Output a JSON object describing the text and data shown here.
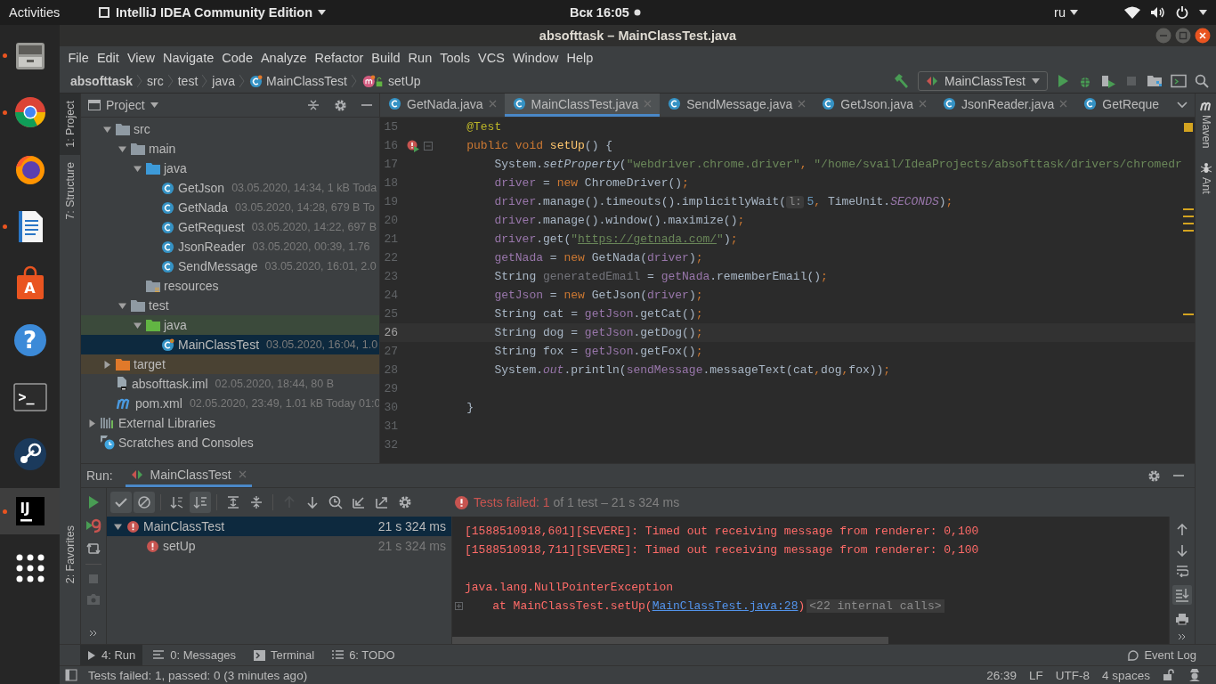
{
  "top_bar": {
    "activities": "Activities",
    "app_menu": "IntelliJ IDEA Community Edition",
    "clock": "Вск 16:05",
    "notification": true,
    "input_source": "ru"
  },
  "dock": [
    {
      "kind": "files",
      "running": true
    },
    {
      "kind": "browser",
      "running": true
    },
    {
      "kind": "fox-browser",
      "running": false
    },
    {
      "kind": "document",
      "running": true
    },
    {
      "kind": "store",
      "glyph": "A",
      "running": false
    },
    {
      "kind": "help",
      "glyph": "?",
      "running": false
    },
    {
      "kind": "terminal",
      "glyph": ">_",
      "running": false
    },
    {
      "kind": "steam",
      "running": false
    },
    {
      "kind": "ide",
      "glyph": "IJ",
      "running": true,
      "selected": true
    },
    {
      "kind": "apps",
      "running": false
    }
  ],
  "window": {
    "title": "absofttask – MainClassTest.java"
  },
  "menu": [
    "File",
    "Edit",
    "View",
    "Navigate",
    "Code",
    "Analyze",
    "Refactor",
    "Build",
    "Run",
    "Tools",
    "VCS",
    "Window",
    "Help"
  ],
  "breadcrumbs": [
    {
      "label": "absofttask",
      "kind": "project"
    },
    {
      "label": "src",
      "kind": "folder"
    },
    {
      "label": "test",
      "kind": "folder"
    },
    {
      "label": "java",
      "kind": "folder"
    },
    {
      "label": "MainClassTest",
      "kind": "class"
    },
    {
      "label": "setUp",
      "kind": "method"
    }
  ],
  "run_config": "MainClassTest",
  "left_tools": [
    {
      "label": "1: Project",
      "selected": true
    },
    {
      "label": "7: Structure",
      "selected": false
    }
  ],
  "left_tools_bottom": [
    {
      "label": "2: Favorites",
      "selected": false
    }
  ],
  "right_tools": [
    {
      "label": "Maven",
      "kind": "maven"
    },
    {
      "label": "Ant",
      "kind": "ant"
    }
  ],
  "project_panel": {
    "title": "Project",
    "tree": [
      {
        "kind": "module-root",
        "children": [
          {
            "name": "src",
            "kind": "folder",
            "expanded": true,
            "selected": false,
            "children": [
              {
                "name": "main",
                "kind": "folder",
                "expanded": true,
                "selected": false,
                "children": [
                  {
                    "name": "java",
                    "kind": "source-folder",
                    "expanded": true,
                    "selected": false,
                    "children": [
                      {
                        "name": "GetJson",
                        "kind": "class",
                        "meta": "03.05.2020, 14:34, 1 kB Toda",
                        "selected": false
                      },
                      {
                        "name": "GetNada",
                        "kind": "class",
                        "meta": "03.05.2020, 14:28, 679 B To",
                        "selected": false
                      },
                      {
                        "name": "GetRequest",
                        "kind": "class",
                        "meta": "03.05.2020, 14:22, 697 B",
                        "selected": false
                      },
                      {
                        "name": "JsonReader",
                        "kind": "class",
                        "meta": "03.05.2020, 00:39, 1.76",
                        "selected": false
                      },
                      {
                        "name": "SendMessage",
                        "kind": "class",
                        "meta": "03.05.2020, 16:01, 2.0",
                        "selected": false
                      }
                    ]
                  },
                  {
                    "name": "resources",
                    "kind": "resources",
                    "selected": false
                  }
                ]
              },
              {
                "name": "test",
                "kind": "folder",
                "expanded": true,
                "selected": false,
                "children": [
                  {
                    "name": "java",
                    "kind": "test-folder",
                    "expanded": true,
                    "selected": false,
                    "children": [
                      {
                        "name": "MainClassTest",
                        "kind": "test-class",
                        "meta": "03.05.2020, 16:04, 1.0",
                        "selected": true
                      }
                    ]
                  }
                ]
              }
            ]
          },
          {
            "name": "target",
            "kind": "excluded",
            "expanded": false,
            "selected": false
          },
          {
            "name": "absofttask.iml",
            "kind": "iml",
            "meta": "02.05.2020, 18:44, 80 B",
            "selected": false
          },
          {
            "name": "pom.xml",
            "kind": "maven",
            "meta": "02.05.2020, 23:49, 1.01 kB Today 01:0",
            "selected": false
          }
        ]
      },
      {
        "name": "External Libraries",
        "kind": "libraries",
        "expanded": false,
        "selected": false
      },
      {
        "name": "Scratches and Consoles",
        "kind": "scratches",
        "selected": false
      }
    ]
  },
  "editor_tabs": [
    {
      "label": "GetNada.java",
      "selected": false,
      "closable": true
    },
    {
      "label": "MainClassTest.java",
      "selected": true,
      "closable": true
    },
    {
      "label": "SendMessage.java",
      "selected": false,
      "closable": true
    },
    {
      "label": "GetJson.java",
      "selected": false,
      "closable": true
    },
    {
      "label": "JsonReader.java",
      "selected": false,
      "closable": true
    },
    {
      "label": "GetReque",
      "selected": false,
      "closable": false
    }
  ],
  "code": [
    {
      "kind": "class-body",
      "children": [
        {
          "number": "15",
          "current": false,
          "tokens": [
            {
              "text": "@Test",
              "kind": "annotation"
            }
          ]
        },
        {
          "number": "16",
          "current": false,
          "kind": "test-failed",
          "tokens": [
            {
              "text": "public void ",
              "kind": "kw"
            },
            {
              "text": "setUp",
              "kind": "method"
            },
            {
              "text": "() {",
              "kind": "plain"
            }
          ],
          "children": [
            {
              "number": "17",
              "current": false,
              "tokens": [
                {
                  "text": "System.",
                  "kind": "plain"
                },
                {
                  "text": "setProperty",
                  "kind": "italic"
                },
                {
                  "text": "(",
                  "kind": "plain"
                },
                {
                  "text": "\"webdriver.chrome.driver\"",
                  "kind": "str"
                },
                {
                  "text": ",",
                  "kind": "kw"
                },
                {
                  "text": " \"/home/svail/IdeaProjects/absofttask/drivers/chromedr",
                  "kind": "str"
                }
              ]
            },
            {
              "number": "18",
              "current": false,
              "tokens": [
                {
                  "text": "driver",
                  "kind": "field"
                },
                {
                  "text": " = ",
                  "kind": "plain"
                },
                {
                  "text": "new ",
                  "kind": "kw"
                },
                {
                  "text": "ChromeDriver()",
                  "kind": "plain"
                },
                {
                  "text": ";",
                  "kind": "kw"
                }
              ]
            },
            {
              "number": "19",
              "current": false,
              "tokens": [
                {
                  "text": "driver",
                  "kind": "field"
                },
                {
                  "text": ".manage().timeouts().implicitlyWait(",
                  "kind": "plain"
                },
                {
                  "text": "l:",
                  "kind": "hint"
                },
                {
                  "text": "5",
                  "kind": "num"
                },
                {
                  "text": ",",
                  "kind": "kw"
                },
                {
                  "text": " TimeUnit.",
                  "kind": "plain"
                },
                {
                  "text": "SECONDS",
                  "kind": "const"
                },
                {
                  "text": ")",
                  "kind": "plain"
                },
                {
                  "text": ";",
                  "kind": "kw"
                }
              ]
            },
            {
              "number": "20",
              "current": false,
              "tokens": [
                {
                  "text": "driver",
                  "kind": "field"
                },
                {
                  "text": ".manage().window().maximize()",
                  "kind": "plain"
                },
                {
                  "text": ";",
                  "kind": "kw"
                }
              ]
            },
            {
              "number": "21",
              "current": false,
              "tokens": [
                {
                  "text": "driver",
                  "kind": "field"
                },
                {
                  "text": ".get(",
                  "kind": "plain"
                },
                {
                  "text": "\"",
                  "kind": "str"
                },
                {
                  "text": "https://getnada.com/",
                  "kind": "link"
                },
                {
                  "text": "\"",
                  "kind": "str"
                },
                {
                  "text": ")",
                  "kind": "plain"
                },
                {
                  "text": ";",
                  "kind": "kw"
                }
              ]
            },
            {
              "number": "22",
              "current": false,
              "tokens": [
                {
                  "text": "getNada",
                  "kind": "field"
                },
                {
                  "text": " = ",
                  "kind": "plain"
                },
                {
                  "text": "new ",
                  "kind": "kw"
                },
                {
                  "text": "GetNada(",
                  "kind": "plain"
                },
                {
                  "text": "driver",
                  "kind": "field"
                },
                {
                  "text": ")",
                  "kind": "plain"
                },
                {
                  "text": ";",
                  "kind": "kw"
                }
              ]
            },
            {
              "number": "23",
              "current": false,
              "tokens": [
                {
                  "text": "String ",
                  "kind": "plain"
                },
                {
                  "text": "generatedEmail",
                  "kind": "unused"
                },
                {
                  "text": " = ",
                  "kind": "plain"
                },
                {
                  "text": "getNada",
                  "kind": "field"
                },
                {
                  "text": ".rememberEmail()",
                  "kind": "plain"
                },
                {
                  "text": ";",
                  "kind": "kw"
                }
              ]
            },
            {
              "number": "24",
              "current": false,
              "tokens": [
                {
                  "text": "getJson",
                  "kind": "field"
                },
                {
                  "text": " = ",
                  "kind": "plain"
                },
                {
                  "text": "new ",
                  "kind": "kw"
                },
                {
                  "text": "GetJson(",
                  "kind": "plain"
                },
                {
                  "text": "driver",
                  "kind": "field"
                },
                {
                  "text": ")",
                  "kind": "plain"
                },
                {
                  "text": ";",
                  "kind": "kw"
                }
              ]
            },
            {
              "number": "25",
              "current": false,
              "tokens": [
                {
                  "text": "String cat = ",
                  "kind": "plain"
                },
                {
                  "text": "getJson",
                  "kind": "field"
                },
                {
                  "text": ".getCat()",
                  "kind": "plain"
                },
                {
                  "text": ";",
                  "kind": "kw"
                }
              ]
            },
            {
              "number": "26",
              "current": true,
              "tokens": [
                {
                  "text": "String dog = ",
                  "kind": "plain"
                },
                {
                  "text": "getJson",
                  "kind": "field"
                },
                {
                  "text": ".getDog()",
                  "kind": "plain"
                },
                {
                  "text": ";",
                  "kind": "kw"
                }
              ]
            },
            {
              "number": "27",
              "current": false,
              "tokens": [
                {
                  "text": "String fox = ",
                  "kind": "plain"
                },
                {
                  "text": "getJson",
                  "kind": "field"
                },
                {
                  "text": ".getFox()",
                  "kind": "plain"
                },
                {
                  "text": ";",
                  "kind": "kw"
                }
              ]
            },
            {
              "number": "28",
              "current": false,
              "tokens": [
                {
                  "text": "System.",
                  "kind": "plain"
                },
                {
                  "text": "out",
                  "kind": "const"
                },
                {
                  "text": ".println(",
                  "kind": "plain"
                },
                {
                  "text": "sendMessage",
                  "kind": "field"
                },
                {
                  "text": ".messageText(cat",
                  "kind": "plain"
                },
                {
                  "text": ",",
                  "kind": "kw"
                },
                {
                  "text": "dog",
                  "kind": "plain"
                },
                {
                  "text": ",",
                  "kind": "kw"
                },
                {
                  "text": "fox))",
                  "kind": "plain"
                },
                {
                  "text": ";",
                  "kind": "kw"
                }
              ]
            },
            {
              "number": "29",
              "current": false
            }
          ]
        },
        {
          "number": "30",
          "current": false,
          "tokens": [
            {
              "text": "}",
              "kind": "plain"
            }
          ]
        },
        {
          "number": "31",
          "current": false
        },
        {
          "number": "32",
          "current": false
        }
      ]
    }
  ],
  "run_panel": {
    "label": "Run:",
    "tab": "MainClassTest",
    "toolbar": [
      {
        "kind": "show-passed",
        "on": true,
        "disabled": false
      },
      {
        "kind": "show-ignored",
        "on": true,
        "disabled": false
      },
      {
        "kind": "sort-alpha",
        "on": false,
        "disabled": false
      },
      {
        "kind": "sort-duration",
        "on": true,
        "disabled": false
      },
      {
        "kind": "expand-all",
        "on": false,
        "disabled": false
      },
      {
        "kind": "collapse-all",
        "on": false,
        "disabled": false
      },
      {
        "kind": "previous",
        "on": false,
        "disabled": true
      },
      {
        "kind": "next",
        "on": false,
        "disabled": false
      },
      {
        "kind": "history",
        "on": false,
        "disabled": false
      },
      {
        "kind": "import",
        "on": false,
        "disabled": false
      },
      {
        "kind": "export",
        "on": false,
        "disabled": false
      },
      {
        "kind": "settings",
        "on": false,
        "disabled": false
      }
    ],
    "status_failed": "Tests failed: 1",
    "status_rest": "of 1 test – 21 s 324 ms",
    "tests": [
      {
        "name": "MainClassTest",
        "time": "21 s 324 ms",
        "kind": "failed",
        "selected": true,
        "expanded": true,
        "children": [
          {
            "name": "setUp",
            "time": "21 s 324 ms",
            "kind": "failed",
            "selected": false
          }
        ]
      }
    ],
    "console": [
      {
        "kind": "error",
        "text": "[1588510918,601][SEVERE]: Timed out receiving message from renderer: 0,100"
      },
      {
        "kind": "error",
        "text": "[1588510918,711][SEVERE]: Timed out receiving message from renderer: 0,100"
      },
      {
        "kind": "blank"
      },
      {
        "kind": "error",
        "text": "java.lang.NullPointerException"
      },
      {
        "kind": "stack",
        "prefix": "    at MainClassTest.setUp(",
        "link": "MainClassTest.java:28",
        "suffix": ")",
        "folded": "<22 internal calls>"
      }
    ]
  },
  "bottom_tabs": [
    {
      "label": "4: Run",
      "kind": "run",
      "selected": true
    },
    {
      "label": "0: Messages",
      "kind": "messages",
      "selected": false
    },
    {
      "label": "Terminal",
      "kind": "terminal",
      "selected": false
    },
    {
      "label": "6: TODO",
      "kind": "todo",
      "selected": false
    }
  ],
  "event_log": "Event Log",
  "status_bar": {
    "message": "Tests failed: 1, passed: 0 (3 minutes ago)",
    "position": "26:39",
    "line_separator": "LF",
    "encoding": "UTF-8",
    "indent": "4 spaces"
  }
}
